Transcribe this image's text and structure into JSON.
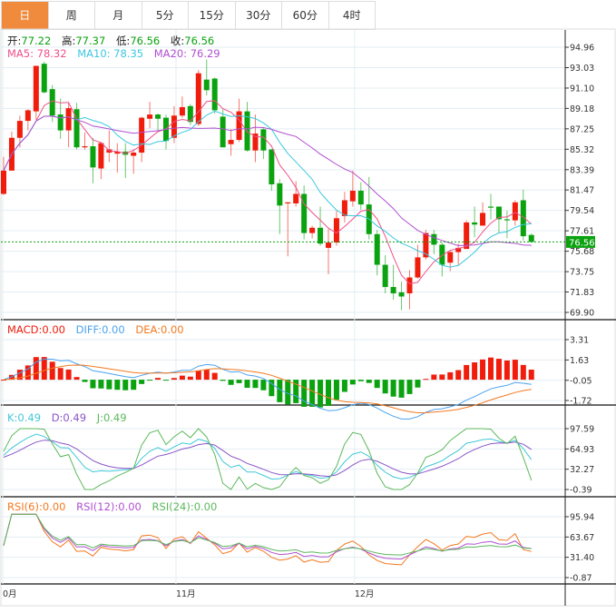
{
  "tabs": [
    "日",
    "周",
    "月",
    "5分",
    "15分",
    "30分",
    "60分",
    "4时"
  ],
  "active_tab": 0,
  "quote": {
    "open_label": "开:",
    "open": "77.22",
    "high_label": "高:",
    "high": "77.37",
    "low_label": "低:",
    "low": "76.56",
    "close_label": "收:",
    "close": "76.56"
  },
  "ma_legend": {
    "ma5": "MA5: 78.32",
    "ma10": "MA10: 78.35",
    "ma20": "MA20: 76.29"
  },
  "macd_legend": {
    "macd": "MACD:0.00",
    "diff": "DIFF:0.00",
    "dea": "DEA:0.00"
  },
  "kdj_legend": {
    "k": "K:0.49",
    "d": "D:0.49",
    "j": "J:0.49"
  },
  "rsi_legend": {
    "rsi6": "RSI(6):0.00",
    "rsi12": "RSI(12):0.00",
    "rsi24": "RSI(24):0.00"
  },
  "current_price": "76.56",
  "colors": {
    "up": "#f01c0c",
    "down": "#0aa20f",
    "ma5": "#f0508a",
    "ma10": "#3cc8e0",
    "ma20": "#b050d0",
    "diff": "#4aa3f0",
    "dea": "#f47920",
    "k": "#40c8d8",
    "d": "#8a55c8",
    "j": "#5cb85c",
    "rsi6": "#f47920",
    "rsi12": "#b050d0",
    "rsi24": "#5cb85c",
    "accent": "#f08a3c"
  },
  "chart_data": {
    "type": "candlestick",
    "price_ticks": [
      "94.96",
      "93.03",
      "91.10",
      "89.18",
      "87.25",
      "85.32",
      "83.39",
      "81.47",
      "79.54",
      "77.61",
      "75.68",
      "73.75",
      "71.83",
      "69.90"
    ],
    "price_range": [
      69.9,
      94.96
    ],
    "macd_ticks": [
      "3.31",
      "1.63",
      "-0.05",
      "-1.72"
    ],
    "macd_range": [
      -1.72,
      3.31
    ],
    "kdj_ticks": [
      "97.59",
      "64.93",
      "32.27",
      "-0.39"
    ],
    "kdj_range": [
      -0.39,
      97.59
    ],
    "rsi_ticks": [
      "95.94",
      "63.67",
      "31.40",
      "-0.87"
    ],
    "rsi_range": [
      -0.87,
      95.94
    ],
    "x_labels": [
      {
        "label": "0月",
        "index": 0
      },
      {
        "label": "11月",
        "index": 21
      },
      {
        "label": "12月",
        "index": 43
      }
    ],
    "candles": [
      [
        81.1,
        84.6,
        81.0,
        83.3
      ],
      [
        83.3,
        87.0,
        83.3,
        86.4
      ],
      [
        86.4,
        88.5,
        85.5,
        88.0
      ],
      [
        88.0,
        89.1,
        87.1,
        89.0
      ],
      [
        88.9,
        93.2,
        88.1,
        93.2
      ],
      [
        93.4,
        93.6,
        90.6,
        90.7
      ],
      [
        91.0,
        91.4,
        87.9,
        88.5
      ],
      [
        88.6,
        90.1,
        86.3,
        87.1
      ],
      [
        87.1,
        89.7,
        85.5,
        89.2
      ],
      [
        89.1,
        89.7,
        85.3,
        85.5
      ],
      [
        85.5,
        86.9,
        85.3,
        85.6
      ],
      [
        85.6,
        86.4,
        82.1,
        83.6
      ],
      [
        83.5,
        86.0,
        82.5,
        85.9
      ],
      [
        85.0,
        87.1,
        84.1,
        85.3
      ],
      [
        84.9,
        85.9,
        83.1,
        85.1
      ],
      [
        85.1,
        85.9,
        82.6,
        84.8
      ],
      [
        84.7,
        85.3,
        83.0,
        85.0
      ],
      [
        85.0,
        88.4,
        84.1,
        88.3
      ],
      [
        88.2,
        89.8,
        87.3,
        88.6
      ],
      [
        88.6,
        88.7,
        87.1,
        88.2
      ],
      [
        88.3,
        88.6,
        85.3,
        86.1
      ],
      [
        86.4,
        89.4,
        85.9,
        88.5
      ],
      [
        88.5,
        90.3,
        88.3,
        89.3
      ],
      [
        89.4,
        89.6,
        87.6,
        87.9
      ],
      [
        87.7,
        92.8,
        87.5,
        92.5
      ],
      [
        91.9,
        93.8,
        90.4,
        90.9
      ],
      [
        92.0,
        92.1,
        88.7,
        89.0
      ],
      [
        88.4,
        89.1,
        85.5,
        85.5
      ],
      [
        85.8,
        87.2,
        84.7,
        86.2
      ],
      [
        86.2,
        90.1,
        86.0,
        88.9
      ],
      [
        88.9,
        89.8,
        85.1,
        85.2
      ],
      [
        85.2,
        88.6,
        84.1,
        86.8
      ],
      [
        87.2,
        87.3,
        84.4,
        85.2
      ],
      [
        85.3,
        85.3,
        81.4,
        82.0
      ],
      [
        82.1,
        82.5,
        77.3,
        80.0
      ],
      [
        80.2,
        80.3,
        75.2,
        80.3
      ],
      [
        80.2,
        82.3,
        79.9,
        81.1
      ],
      [
        81.1,
        81.9,
        76.8,
        77.4
      ],
      [
        77.4,
        78.1,
        76.9,
        77.9
      ],
      [
        77.9,
        79.9,
        76.2,
        76.4
      ],
      [
        76.0,
        77.8,
        73.5,
        76.5
      ],
      [
        76.5,
        79.5,
        76.2,
        78.8
      ],
      [
        79.0,
        81.3,
        78.4,
        80.5
      ],
      [
        80.4,
        83.3,
        79.9,
        81.4
      ],
      [
        81.4,
        82.2,
        79.6,
        80.1
      ],
      [
        80.1,
        82.7,
        76.8,
        77.3
      ],
      [
        77.3,
        77.7,
        73.4,
        74.4
      ],
      [
        74.4,
        75.3,
        71.7,
        72.3
      ],
      [
        72.3,
        74.4,
        71.1,
        71.7
      ],
      [
        71.8,
        72.8,
        70.1,
        71.4
      ],
      [
        71.7,
        73.9,
        70.2,
        73.2
      ],
      [
        73.2,
        76.3,
        73.1,
        75.1
      ],
      [
        75.1,
        77.7,
        74.9,
        77.4
      ],
      [
        77.3,
        77.7,
        75.4,
        76.3
      ],
      [
        76.3,
        76.5,
        73.3,
        74.4
      ],
      [
        74.6,
        75.7,
        73.8,
        75.6
      ],
      [
        75.6,
        76.4,
        74.4,
        76.0
      ],
      [
        75.9,
        78.6,
        75.9,
        78.4
      ],
      [
        78.4,
        79.9,
        77.0,
        78.2
      ],
      [
        78.1,
        80.3,
        78.1,
        79.3
      ],
      [
        79.9,
        81.1,
        78.7,
        79.8
      ],
      [
        79.9,
        79.9,
        77.4,
        78.7
      ],
      [
        78.7,
        79.5,
        76.9,
        78.6
      ],
      [
        78.6,
        80.5,
        78.1,
        80.3
      ],
      [
        80.5,
        81.5,
        76.7,
        77.1
      ],
      [
        77.22,
        77.37,
        76.56,
        76.56
      ]
    ],
    "candle_fields": [
      "open",
      "high",
      "low",
      "close"
    ]
  }
}
